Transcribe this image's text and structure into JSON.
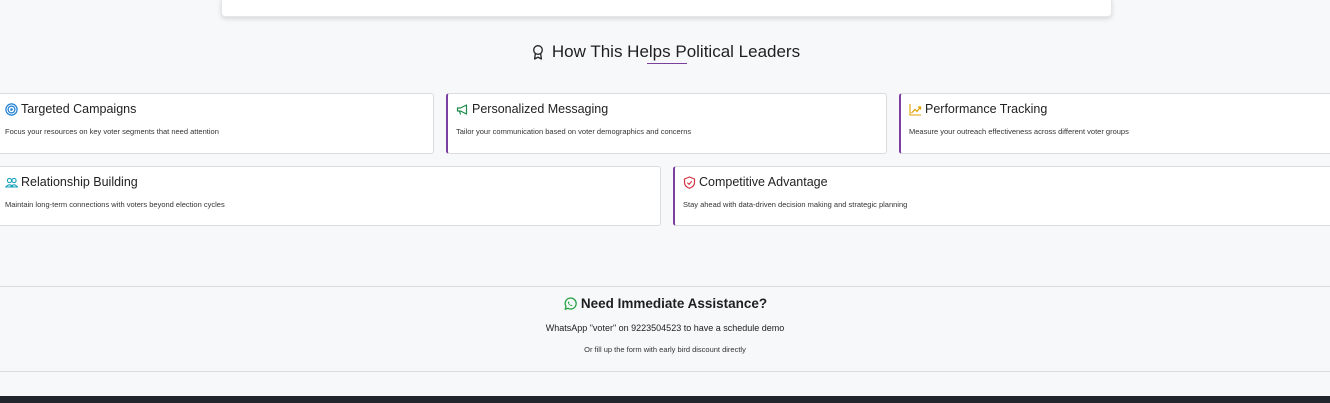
{
  "section": {
    "title": "How This Helps Political Leaders",
    "title_icon": "award-icon",
    "accent_color": "#7b3fa0"
  },
  "benefits": [
    {
      "title": "Targeted Campaigns",
      "description": "Focus your resources on key voter segments that need attention",
      "icon": "target-icon",
      "icon_color": "#1e7fd6"
    },
    {
      "title": "Personalized Messaging",
      "description": "Tailor your communication based on voter demographics and concerns",
      "icon": "megaphone-icon",
      "icon_color": "#1b8a4b"
    },
    {
      "title": "Performance Tracking",
      "description": "Measure your outreach effectiveness across different voter groups",
      "icon": "trending-up-icon",
      "icon_color": "#e0a000"
    },
    {
      "title": "Relationship Building",
      "description": "Maintain long-term connections with voters beyond election cycles",
      "icon": "users-icon",
      "icon_color": "#17a2b8"
    },
    {
      "title": "Competitive Advantage",
      "description": "Stay ahead with data-driven decision making and strategic planning",
      "icon": "shield-icon",
      "icon_color": "#d63343"
    }
  ],
  "assistance": {
    "title": "Need Immediate Assistance?",
    "icon": "whatsapp-icon",
    "icon_color": "#25a244",
    "line1": "WhatsApp \"voter\" on 9223504523 to have a schedule demo",
    "line2": "Or fill up the form with early bird discount directly"
  }
}
